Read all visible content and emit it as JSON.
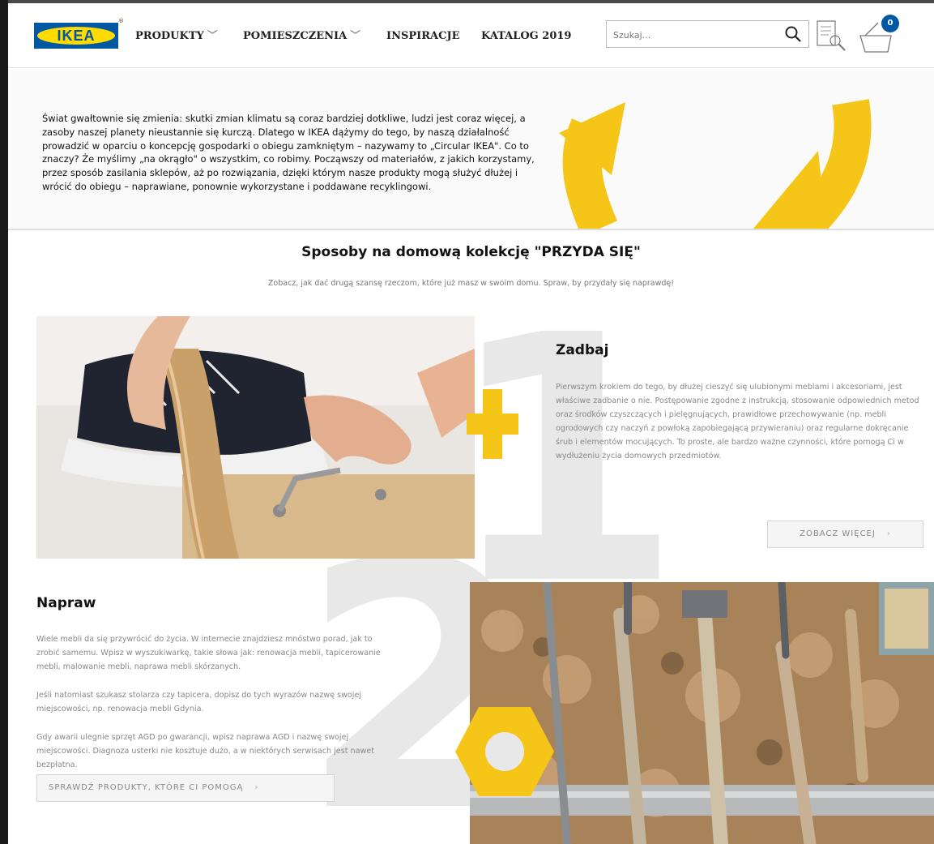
{
  "header": {
    "logo_text": "IKEA",
    "logo_reg": "®",
    "nav": [
      {
        "label": "PRODUKTY",
        "has_dropdown": true
      },
      {
        "label": "POMIESZCZENIA",
        "has_dropdown": true
      },
      {
        "label": "INSPIRACJE",
        "has_dropdown": false
      },
      {
        "label": "KATALOG 2019",
        "has_dropdown": false
      }
    ],
    "chevron": "﹀",
    "search_placeholder": "Szukaj...",
    "cart_count": "0",
    "icons": [
      "search-icon",
      "shopping-list-icon",
      "cart-icon"
    ]
  },
  "intro": {
    "text": "Świat gwałtownie się zmienia: skutki zmian klimatu są coraz bardziej dotkliwe, ludzi jest coraz więcej, a zasoby naszej planety nieustannie się kurczą. Dlatego w IKEA dążymy do tego, by naszą działalność prowadzić w oparciu o koncepcję gospodarki o obiegu zamkniętym – nazywamy to „Circular IKEA\". Co to znaczy? Że myślimy „na okrągło\" o wszystkim, co robimy. Począwszy od materiałów, z jakich korzystamy, przez sposób zasilania sklepów, aż po rozwiązania, dzięki którym nasze produkty mogą służyć dłużej i wrócić do obiegu – naprawiane, ponownie wykorzystane i poddawane recyklingowi."
  },
  "section": {
    "title": "Sposoby na domową kolekcję \"PRZYDA SIĘ\"",
    "subtitle": "Zobacz, jak dać drugą szansę rzeczom, które już masz w swoim domu. Spraw, by przydały się naprawdę!"
  },
  "zadbaj": {
    "number": "1",
    "title": "Zadbaj",
    "text": "Pierwszym krokiem do tego, by dłużej cieszyć się ulubionymi meblami i akcesoriami, jest właściwe zadbanie o nie. Postępowanie zgodne z instrukcją, stosowanie odpowiednich metod oraz środków czyszczących i pielęgnujących, prawidłowe przechowywanie (np. mebli ogrodowych czy naczyń z powłoką zapobiegającą przywieraniu) oraz regularne dokręcanie śrub i elementów mocujących. To proste, ale bardzo ważne czynności, które pomogą Ci w wydłużeniu życia domowych przedmiotów.",
    "button": "ZOBACZ WIĘCEJ",
    "button_arrow": "›"
  },
  "napraw": {
    "number": "2",
    "title": "Napraw",
    "p1": "Wiele mebli da się przywrócić do życia. W internecie znajdziesz mnóstwo porad, jak to zrobić samemu. Wpisz w wyszukiwarkę, takie słowa jak: renowacja mebli, tapicerowanie mebli, malowanie mebli, naprawa mebli skórzanych.",
    "p2": "Jeśli natomiast szukasz stolarza czy tapicera, dopisz do tych wyrazów nazwę swojej miejscowości, np. renowacja mebli Gdynia.",
    "p3": "Gdy awarii ulegnie sprzęt AGD po gwarancji, wpisz naprawa AGD i nazwę swojej miejscowości. Diagnoza usterki nie kosztuje dużo, a w niektórych serwisach jest nawet bezpłatna.",
    "button": "SPRAWDŹ PRODUKTY, KTÓRE CI POMOGĄ",
    "button_arrow": "›"
  },
  "colors": {
    "ikea_blue": "#0058a3",
    "ikea_yellow": "#ffdb00",
    "accent_yellow": "#f5c518",
    "bg_number": "#e8e8e8"
  }
}
